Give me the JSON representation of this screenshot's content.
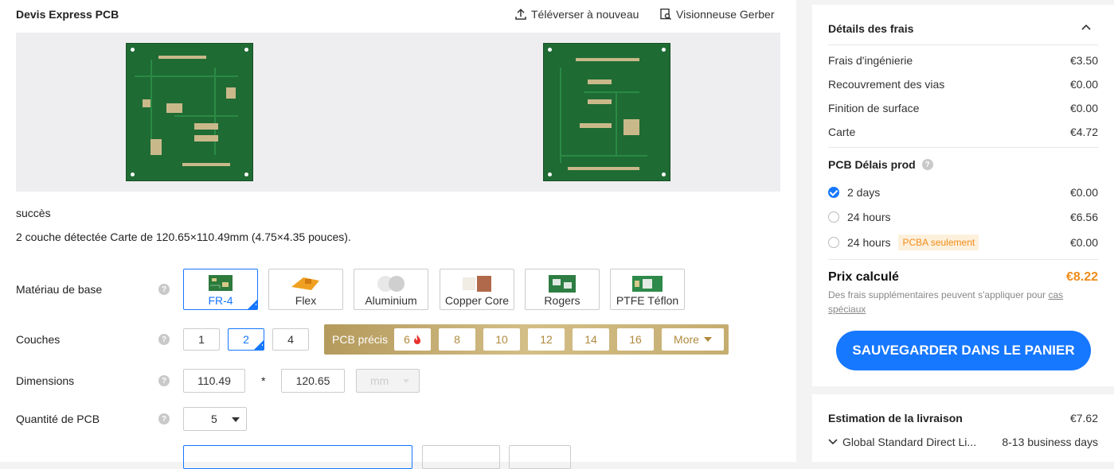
{
  "header": {
    "title": "Devis Express PCB",
    "upload_label": "Téléverser à nouveau",
    "gerber_label": "Visionneuse Gerber"
  },
  "status": {
    "success": "succès",
    "detected": "2 couche détectée Carte de 120.65×110.49mm (4.75×4.35 pouces)."
  },
  "base_material": {
    "label": "Matériau de base",
    "options": [
      "FR-4",
      "Flex",
      "Aluminium",
      "Copper Core",
      "Rogers",
      "PTFE Téflon"
    ],
    "selected": "FR-4"
  },
  "layers": {
    "label": "Couches",
    "options": [
      "1",
      "2",
      "4"
    ],
    "selected": "2",
    "precision_label": "PCB précis",
    "precision_options": [
      "6",
      "8",
      "10",
      "12",
      "14",
      "16"
    ],
    "more_label": "More"
  },
  "dimensions": {
    "label": "Dimensions",
    "width": "110.49",
    "times": "*",
    "height": "120.65",
    "unit": "mm"
  },
  "quantity": {
    "label": "Quantité de PCB",
    "value": "5"
  },
  "fees": {
    "title": "Détails des frais",
    "items": [
      {
        "label": "Frais d'ingénierie",
        "value": "€3.50"
      },
      {
        "label": "Recouvrement des vias",
        "value": "€0.00"
      },
      {
        "label": "Finition de surface",
        "value": "€0.00"
      },
      {
        "label": "Carte",
        "value": "€4.72"
      }
    ],
    "lead_title": "PCB Délais prod",
    "lead_options": [
      {
        "label": "2 days",
        "value": "€0.00",
        "selected": true
      },
      {
        "label": "24 hours",
        "value": "€6.56",
        "selected": false
      },
      {
        "label": "24 hours",
        "value": "€0.00",
        "selected": false,
        "badge": "PCBA seulement"
      }
    ],
    "price_label": "Prix calculé",
    "price_value": "€8.22",
    "note_prefix": "Des frais supplémentaires peuvent s'appliquer pour",
    "note_link": "cas spéciaux",
    "cart_label": "SAUVEGARDER DANS LE PANIER"
  },
  "shipping": {
    "title": "Estimation de la livraison",
    "price": "€7.62",
    "method": "Global Standard Direct Li...",
    "time": "8-13 business days"
  },
  "colors": {
    "accent": "#1677ff",
    "price": "#f08c1a",
    "pcb_green": "#1f6b34",
    "gold": "#c5ad70"
  }
}
